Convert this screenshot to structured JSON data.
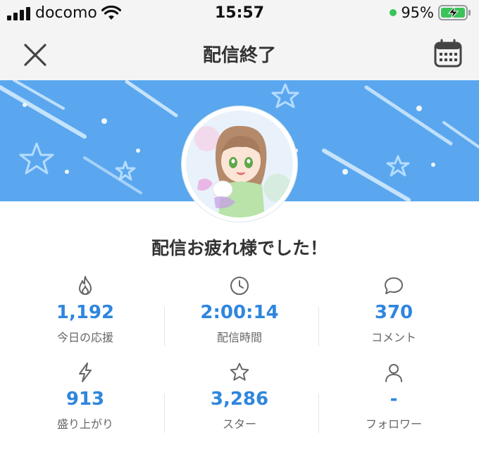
{
  "status_bar": {
    "carrier": "docomo",
    "time": "15:57",
    "battery": "95%"
  },
  "header": {
    "title": "配信終了"
  },
  "thanks_message": "配信お疲れ様でした！",
  "stats": [
    {
      "icon": "flame-icon",
      "value": "1,192",
      "label": "今日の応援"
    },
    {
      "icon": "clock-icon",
      "value": "2:00:14",
      "label": "配信時間"
    },
    {
      "icon": "comment-icon",
      "value": "370",
      "label": "コメント"
    },
    {
      "icon": "lightning-icon",
      "value": "913",
      "label": "盛り上がり"
    },
    {
      "icon": "star-icon",
      "value": "3,286",
      "label": "スター"
    },
    {
      "icon": "person-icon",
      "value": "-",
      "label": "フォロワー"
    }
  ],
  "colors": {
    "accent": "#2f86de",
    "banner": "#5aa7ef",
    "battery_green": "#3bc35a"
  }
}
